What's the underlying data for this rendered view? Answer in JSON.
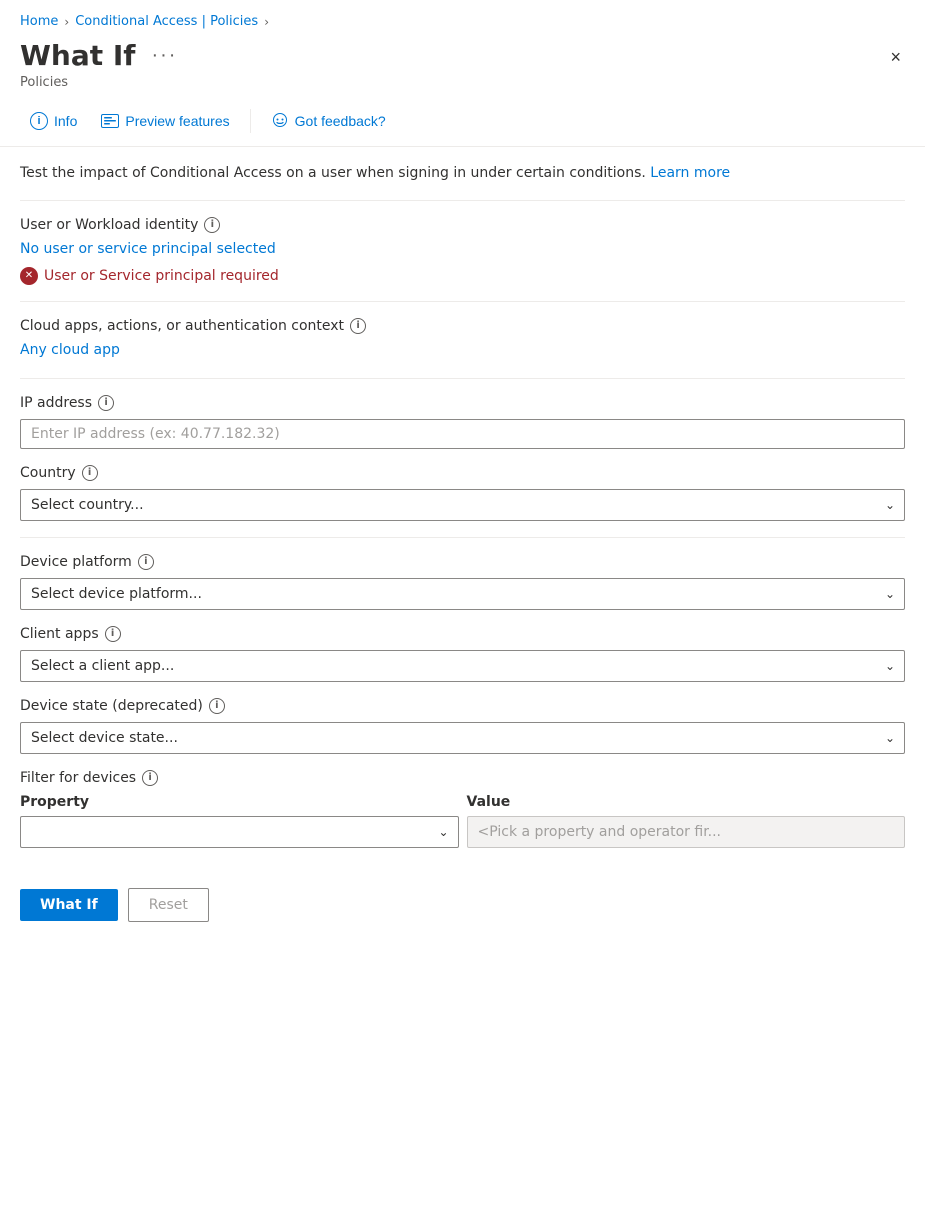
{
  "breadcrumb": {
    "home": "Home",
    "conditional_access": "Conditional Access | Policies",
    "sep1": "›",
    "sep2": "›"
  },
  "header": {
    "title": "What If",
    "ellipsis": "···",
    "subtitle": "Policies",
    "close_label": "×"
  },
  "toolbar": {
    "info_label": "Info",
    "preview_label": "Preview features",
    "feedback_label": "Got feedback?"
  },
  "description": {
    "text": "Test the impact of Conditional Access on a user when signing in under certain conditions.",
    "learn_more": "Learn more"
  },
  "form": {
    "user_identity": {
      "label": "User or Workload identity",
      "link_text": "No user or service principal selected",
      "error_text": "User or Service principal required"
    },
    "cloud_apps": {
      "label": "Cloud apps, actions, or authentication context",
      "link_text": "Any cloud app"
    },
    "ip_address": {
      "label": "IP address",
      "placeholder": "Enter IP address (ex: 40.77.182.32)"
    },
    "country": {
      "label": "Country",
      "placeholder": "Select country...",
      "options": [
        "Select country..."
      ]
    },
    "device_platform": {
      "label": "Device platform",
      "placeholder": "Select device platform...",
      "options": [
        "Select device platform..."
      ]
    },
    "client_apps": {
      "label": "Client apps",
      "placeholder": "Select a client app...",
      "options": [
        "Select a client app..."
      ]
    },
    "device_state": {
      "label": "Device state (deprecated)",
      "placeholder": "Select device state...",
      "options": [
        "Select device state..."
      ]
    },
    "filter_devices": {
      "label": "Filter for devices",
      "col_property": "Property",
      "col_value": "Value",
      "value_placeholder": "<Pick a property and operator fir..."
    }
  },
  "buttons": {
    "what_if": "What If",
    "reset": "Reset"
  }
}
